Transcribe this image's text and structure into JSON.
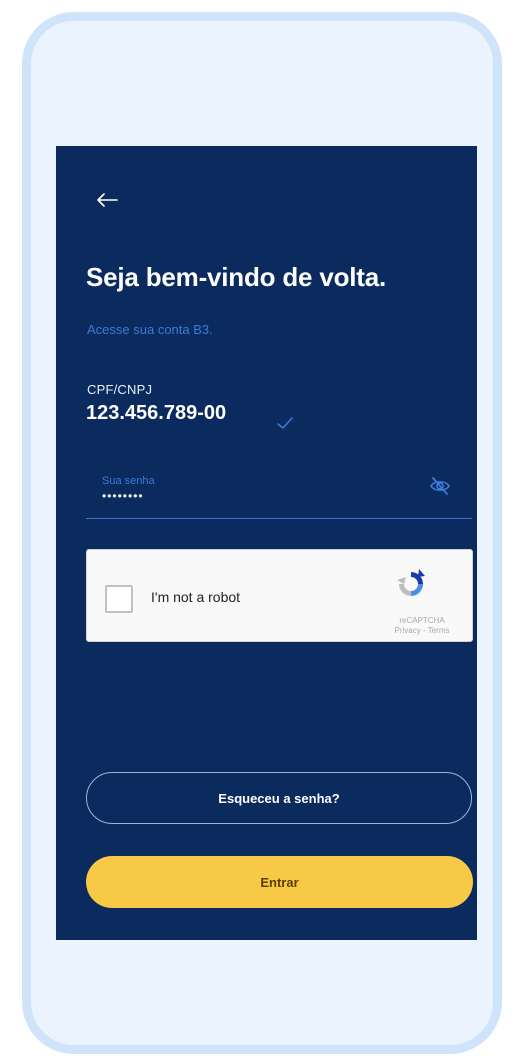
{
  "login": {
    "title": "Seja bem-vindo de volta.",
    "subtitle": "Acesse sua conta B3.",
    "document_label": "CPF/CNPJ",
    "document_value": "123.456.789-00",
    "password_label": "Sua senha",
    "password_value": "••••••••",
    "forgot_password_label": "Esqueceu a senha?",
    "submit_label": "Entrar"
  },
  "recaptcha": {
    "checkbox_label": "I'm not a robot",
    "brand": "reCAPTCHA",
    "links": "Privacy - Terms"
  },
  "icons": {
    "back": "back-arrow-icon",
    "verified": "check-icon",
    "toggle_password": "eye-slash-icon",
    "recaptcha": "recaptcha-logo-icon"
  },
  "colors": {
    "screen_background": "#0b2a5e",
    "accent_blue": "#3d7ad6",
    "primary_button": "#f8c945",
    "frame": "#cfe4fb"
  }
}
